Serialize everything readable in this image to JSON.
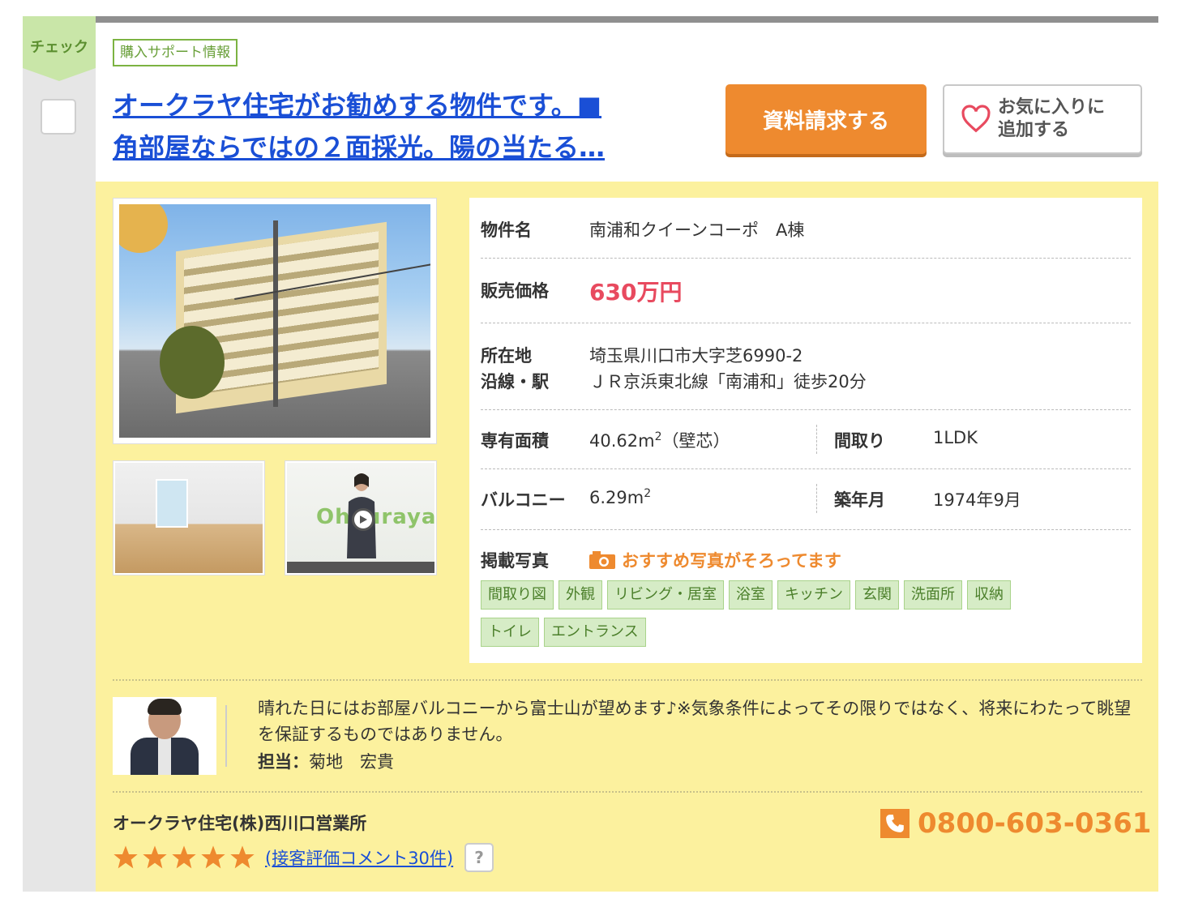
{
  "check": {
    "label": "チェック"
  },
  "header": {
    "support_badge": "購入サポート情報",
    "title_line1": "オークラヤ住宅がお勧めする物件です。■",
    "title_line2": "角部屋ならではの２面採光。陽の当たる…",
    "request_button": "資料請求する",
    "favorite_line1": "お気に入りに",
    "favorite_line2": "追加する"
  },
  "photos": {
    "video_brand": "Ohkuraya"
  },
  "details": {
    "name_label": "物件名",
    "name_value": "南浦和クイーンコーポ　A棟",
    "price_label": "販売価格",
    "price_value": "630万円",
    "address_label": "所在地",
    "address_value": "埼玉県川口市大字芝6990-2",
    "station_label": "沿線・駅",
    "station_value": "ＪＲ京浜東北線「南浦和」徒歩20分",
    "area_label": "専有面積",
    "area_value": "40.62m",
    "area_sup": "2",
    "area_suffix": "（壁芯）",
    "layout_label": "間取り",
    "layout_value": "1LDK",
    "balcony_label": "バルコニー",
    "balcony_value": "6.29m",
    "balcony_sup": "2",
    "built_label": "築年月",
    "built_value": "1974年9月",
    "photos_label": "掲載写真",
    "photos_note": "おすすめ写真がそろってます",
    "tags": [
      "間取り図",
      "外観",
      "リビング・居室",
      "浴室",
      "キッチン",
      "玄関",
      "洗面所",
      "収納",
      "トイレ",
      "エントランス"
    ]
  },
  "staff": {
    "comment": "晴れた日にはお部屋バルコニーから富士山が望めます♪※気象条件によってその限りではなく、将来にわたって眺望を保証するものではありません。",
    "tantou_label": "担当：",
    "tantou_name": "菊地　宏貴"
  },
  "footer": {
    "company": "オークラヤ住宅(株)西川口営業所",
    "rating_stars": 5,
    "review_link": "(接客評価コメント30件)",
    "help": "?",
    "phone": "0800-603-0361"
  },
  "colors": {
    "accent_orange": "#ee8a2f",
    "link_blue": "#1a4fd6",
    "price_red": "#e84a5f",
    "panel_yellow": "#fcf19e",
    "tag_green": "#d6ecc6"
  }
}
